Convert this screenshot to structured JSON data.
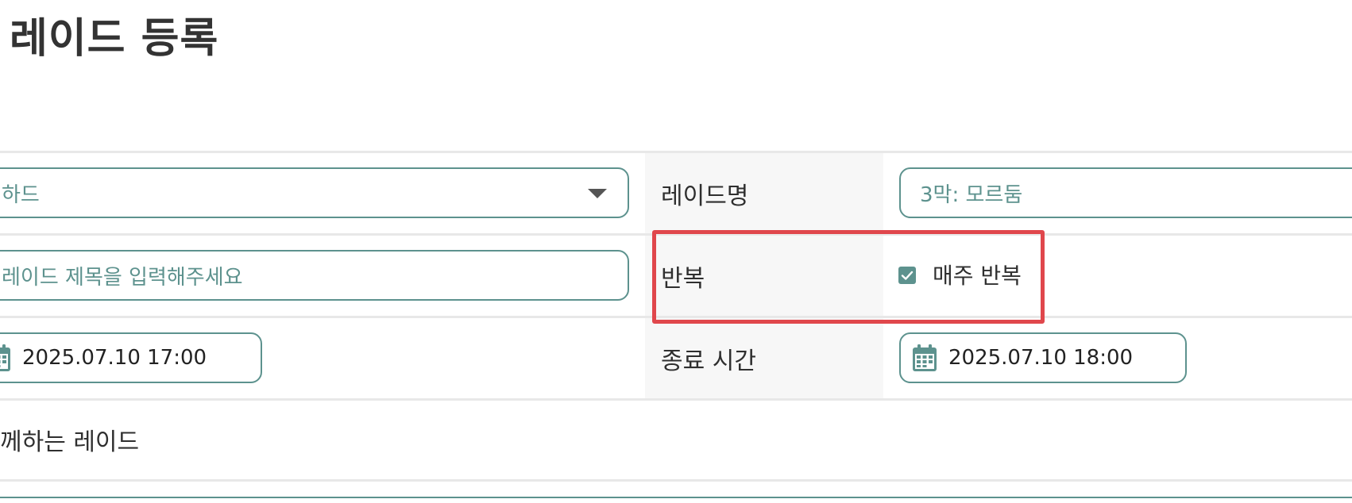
{
  "page": {
    "title": "레이드 등록"
  },
  "form": {
    "difficulty": {
      "value": "하드"
    },
    "raid_name": {
      "label": "레이드명",
      "value": "3막: 모르둠"
    },
    "raid_title": {
      "placeholder": "레이드 제목을 입력해주세요"
    },
    "repeat": {
      "label": "반복",
      "checkbox_label": "매주 반복",
      "checked": true
    },
    "start_time": {
      "value": "2025.07.10 17:00"
    },
    "end_time": {
      "label": "종료 시간",
      "value": "2025.07.10 18:00"
    },
    "section_text": "께하는 레이드"
  },
  "colors": {
    "accent": "#5d928e",
    "highlight": "#e0474c",
    "label_bg": "#f7f7f7"
  },
  "icons": {
    "dropdown": "chevron-down-icon",
    "calendar": "calendar-icon",
    "check": "check-icon"
  }
}
